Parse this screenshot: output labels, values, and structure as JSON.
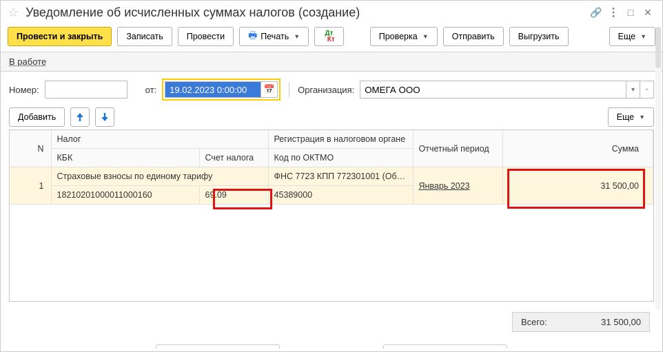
{
  "title": "Уведомление об исчисленных суммах налогов (создание)",
  "toolbar": {
    "post_close": "Провести и закрыть",
    "write": "Записать",
    "post": "Провести",
    "print": "Печать",
    "check": "Проверка",
    "send": "Отправить",
    "upload": "Выгрузить",
    "more": "Еще"
  },
  "status_link": "В работе",
  "form": {
    "number_label": "Номер:",
    "number_value": "",
    "date_label": "от:",
    "date_value": "19.02.2023  0:00:00",
    "org_label": "Организация:",
    "org_value": "ОМЕГА ООО"
  },
  "tbl_bar": {
    "add": "Добавить",
    "more": "Еще"
  },
  "headers": {
    "n": "N",
    "tax": "Налог",
    "kbk": "КБК",
    "acct": "Счет налога",
    "reg": "Регистрация в налоговом органе",
    "oktmo": "Код по ОКТМО",
    "period": "Отчетный период",
    "sum": "Сумма"
  },
  "row": {
    "n": "1",
    "tax": "Страховые взносы по единому тарифу",
    "kbk": "18210201000011000160",
    "acct": "69.09",
    "reg": "ФНС 7723 КПП 772301001 (Об…",
    "oktmo": "45389000",
    "period": "Январь 2023",
    "sum": "31 500,00"
  },
  "footer": {
    "total_label": "Всего:",
    "total_value": "31 500,00"
  }
}
